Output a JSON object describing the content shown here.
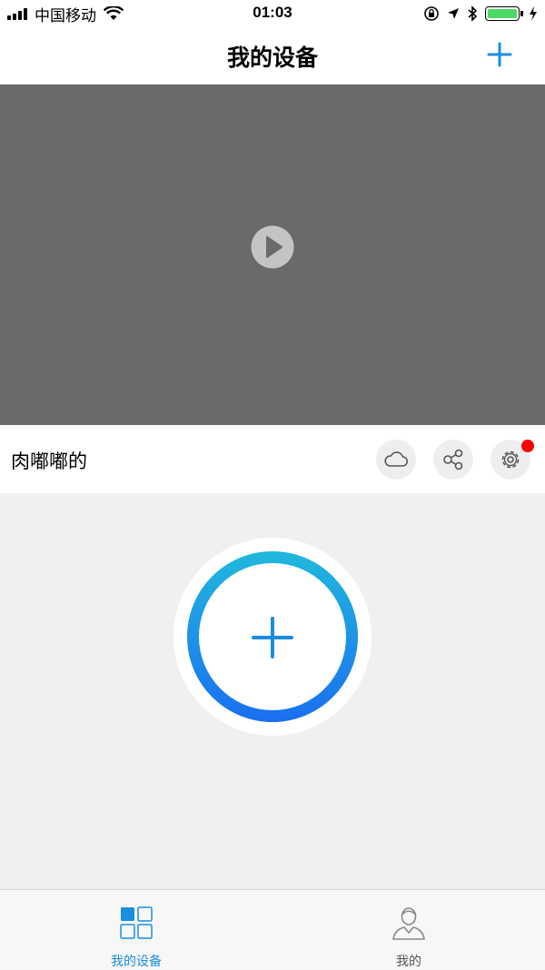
{
  "status_bar": {
    "carrier": "中国移动",
    "time": "01:03",
    "battery_level": 1.0
  },
  "nav": {
    "title": "我的设备"
  },
  "device": {
    "name": "肉嘟嘟的"
  },
  "tabs": [
    {
      "label": "我的设备",
      "active": true
    },
    {
      "label": "我的",
      "active": false
    }
  ],
  "colors": {
    "accent": "#1a8de0",
    "active_tab": "#1a8de0",
    "inactive_tab": "#888888",
    "badge": "#ff0000",
    "video_bg": "#6a6a6a",
    "ring_start": "#20b8dc",
    "ring_end": "#1a6ff0"
  },
  "icons": {
    "nav_add": "plus-icon",
    "video": "play-icon",
    "cloud": "cloud-icon",
    "share": "share-icon",
    "settings": "gear-icon",
    "big_add": "plus-icon",
    "tab_devices": "grid-icon",
    "tab_me": "user-icon"
  }
}
